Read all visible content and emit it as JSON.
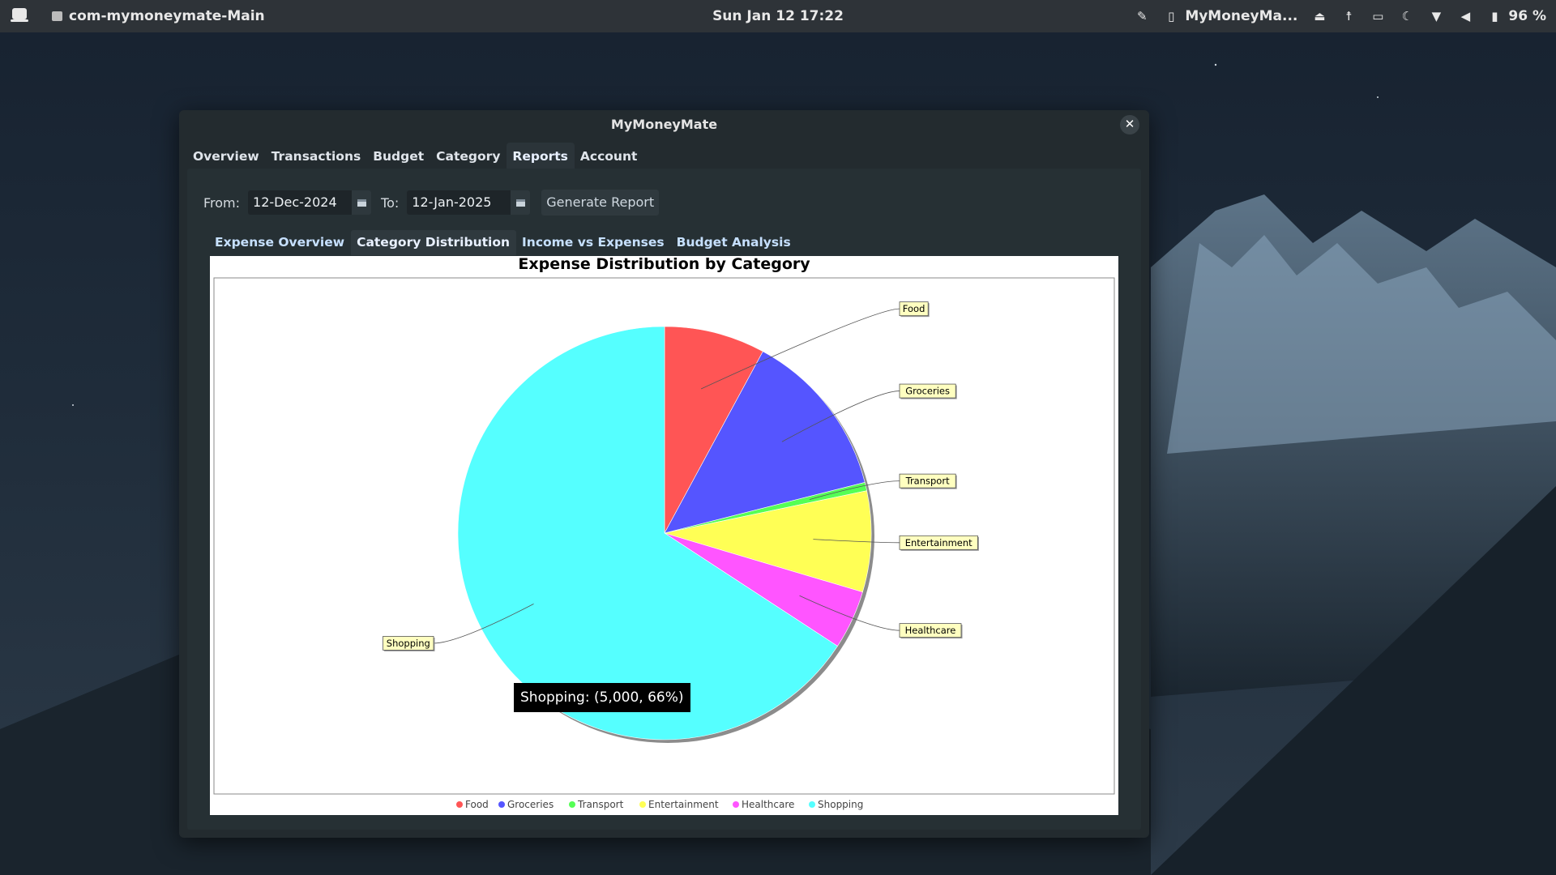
{
  "topbar": {
    "app_name": "com-mymoneymate-Main",
    "clock": "Sun Jan 12  17:22",
    "tray_app": "MyMoneyMa...",
    "battery": "96 %"
  },
  "window": {
    "title": "MyMoneyMate",
    "close": "✕"
  },
  "main_tabs": [
    {
      "label": "Overview"
    },
    {
      "label": "Transactions"
    },
    {
      "label": "Budget"
    },
    {
      "label": "Category"
    },
    {
      "label": "Reports",
      "active": true
    },
    {
      "label": "Account"
    }
  ],
  "report_controls": {
    "from_label": "From:",
    "from_value": "12-Dec-2024",
    "to_label": "To:",
    "to_value": "12-Jan-2025",
    "generate_label": "Generate Report"
  },
  "sub_tabs": [
    {
      "label": "Expense Overview"
    },
    {
      "label": "Category Distribution",
      "active": true
    },
    {
      "label": "Income vs Expenses"
    },
    {
      "label": "Budget Analysis"
    }
  ],
  "tooltip": "Shopping: (5,000, 66%)",
  "chart_data": {
    "type": "pie",
    "title": "Expense Distribution by Category",
    "categories": [
      "Food",
      "Groceries",
      "Transport",
      "Entertainment",
      "Healthcare",
      "Shopping"
    ],
    "values": [
      600,
      1000,
      50,
      600,
      350,
      5000
    ],
    "colors": [
      "#ff5555",
      "#5555ff",
      "#55ff55",
      "#ffff55",
      "#ff55ff",
      "#55ffff"
    ],
    "legend": "bottom",
    "start_angle_deg": 90,
    "direction": "clockwise"
  }
}
